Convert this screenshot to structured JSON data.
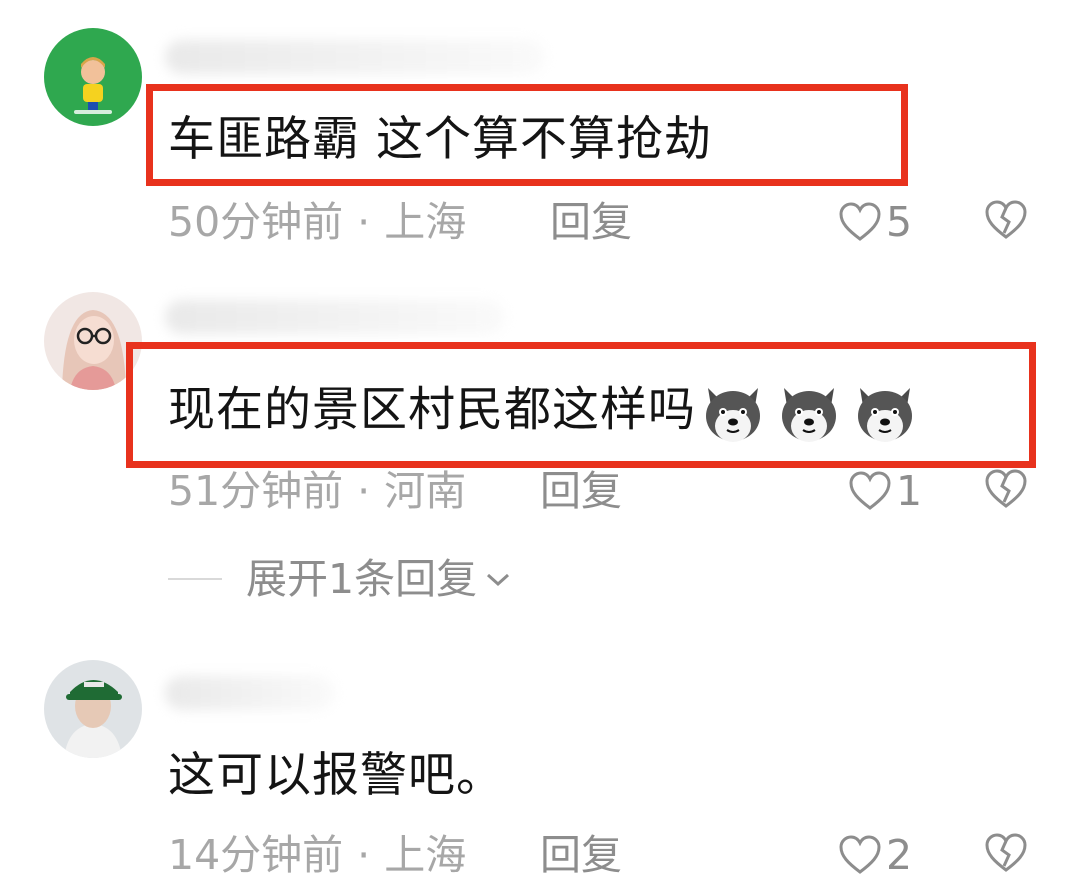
{
  "comments": [
    {
      "text": "车匪路霸  这个算不算抢劫",
      "time": "50分钟前",
      "separator": "·",
      "location": "上海",
      "reply_label": "回复",
      "likes": "5",
      "avatar_color": "#2fa84f"
    },
    {
      "text": "现在的景区村民都这样吗",
      "emoji_icon": "husky-dog-emoji",
      "emoji_count": 3,
      "time": "51分钟前",
      "separator": "·",
      "location": "河南",
      "reply_label": "回复",
      "likes": "1",
      "expand_label": "展开1条回复",
      "avatar_color": "#e9c9c2"
    },
    {
      "text": "这可以报警吧。",
      "time": "14分钟前",
      "separator": "·",
      "location": "上海",
      "reply_label": "回复",
      "likes": "2",
      "avatar_color": "#d8dcdf"
    }
  ],
  "colors": {
    "highlight": "#e8321d",
    "meta_text": "#a7a7a7",
    "action_text": "#8d8d8d"
  }
}
